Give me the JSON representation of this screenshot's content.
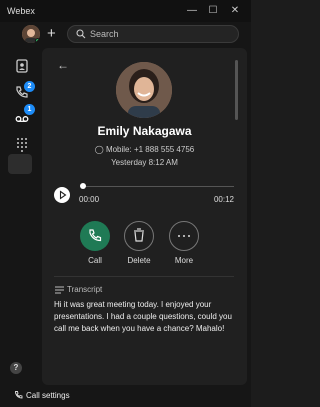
{
  "window": {
    "app_name": "Webex",
    "controls": {
      "minimize": "—",
      "maximize": "☐",
      "close": "✕"
    }
  },
  "topbar": {
    "new_label": "+",
    "search_placeholder": "Search"
  },
  "rail": {
    "items": [
      {
        "icon": "contacts-icon"
      },
      {
        "icon": "calls-icon",
        "badge": "2"
      },
      {
        "icon": "voicemail-icon",
        "badge": "1",
        "selected": true
      },
      {
        "icon": "dialpad-icon"
      }
    ],
    "help_label": "?",
    "call_settings_label": "Call settings"
  },
  "contact": {
    "back_label": "←",
    "name": "Emily Nakagawa",
    "phone": "Mobile: +1 888 555 4756",
    "time": "Yesterday 8:12 AM"
  },
  "player": {
    "elapsed": "00:00",
    "duration": "00:12",
    "progress": 0
  },
  "actions": [
    {
      "label": "Call"
    },
    {
      "label": "Delete"
    },
    {
      "label": "More"
    }
  ],
  "transcript": {
    "label": "Transcript",
    "text": "Hi it was great meeting today. I enjoyed your presentations. I had a couple questions, could you call me back when you have a chance? Mahalo!"
  },
  "colors": {
    "call_button": "#1f7a55",
    "badge": "#1d8cf8",
    "presence": "#2cc56f"
  }
}
